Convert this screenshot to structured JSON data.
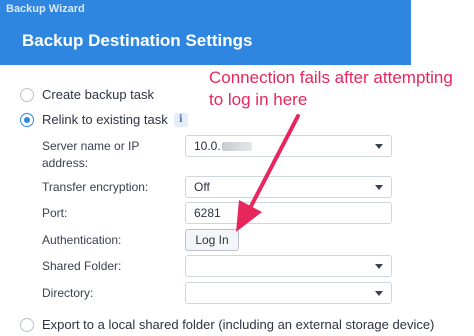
{
  "header": {
    "wizard_title": "Backup Wizard",
    "page_title": "Backup Destination Settings",
    "bg_color": "#2f86e0"
  },
  "options": {
    "create_label": "Create backup task",
    "relink_label": "Relink to existing task",
    "export_label": "Export to a local shared folder (including an external storage device)",
    "selected": "relink"
  },
  "form": {
    "server_label": "Server name or IP address:",
    "server_value": "10.0.",
    "encryption_label": "Transfer encryption:",
    "encryption_value": "Off",
    "port_label": "Port:",
    "port_value": "6281",
    "auth_label": "Authentication:",
    "login_button": "Log In",
    "shared_folder_label": "Shared Folder:",
    "shared_folder_value": "",
    "directory_label": "Directory:",
    "directory_value": ""
  },
  "annotation": {
    "line1": "Connection fails after attempting",
    "line2": "to log in here",
    "color": "#e8265e"
  },
  "icons": {
    "info": "info-icon",
    "dropdown": "chevron-down-icon"
  }
}
